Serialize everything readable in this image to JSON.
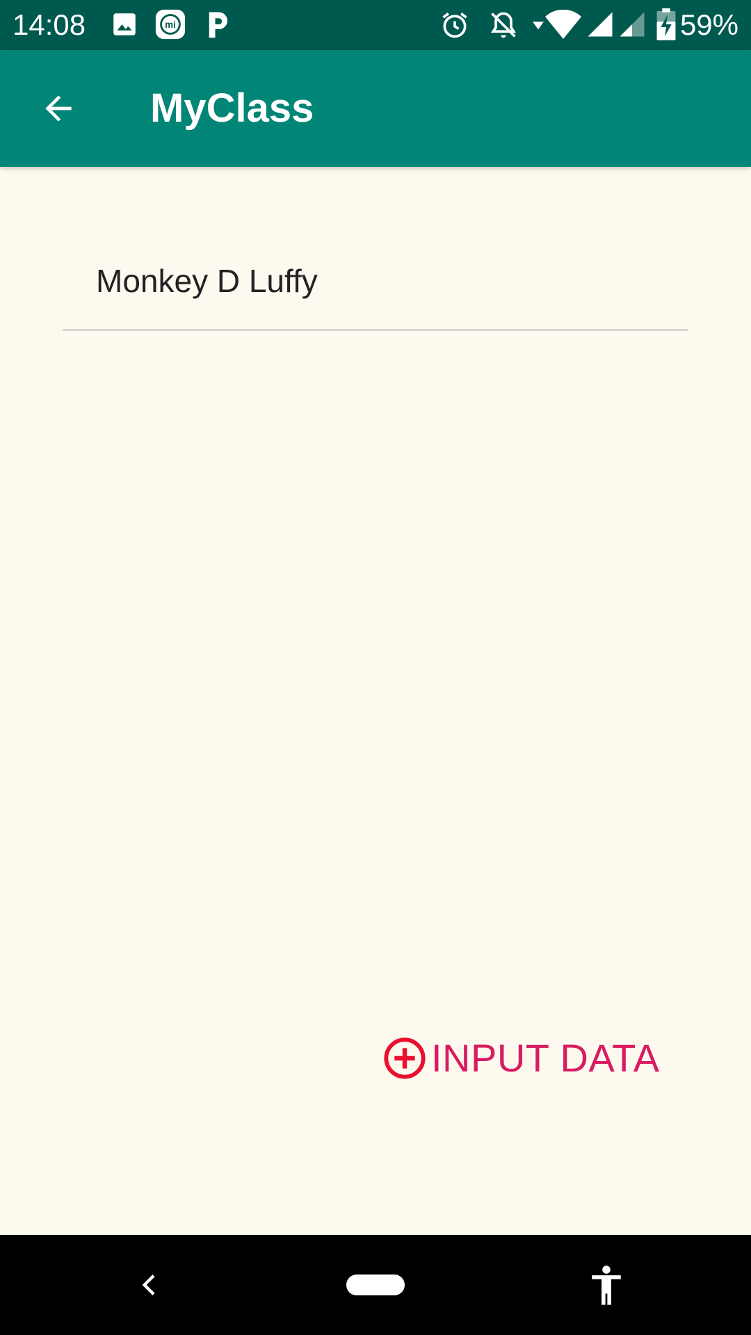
{
  "status_bar": {
    "time": "14:08",
    "battery_percent": "59%",
    "icons": [
      "image-icon",
      "mi-app-icon",
      "p-app-icon",
      "alarm-icon",
      "notifications-off-icon",
      "wifi-icon",
      "signal-icon",
      "signal-weak-icon",
      "battery-charging-icon"
    ]
  },
  "app_bar": {
    "title": "MyClass",
    "back_icon": "arrow-back-icon"
  },
  "form": {
    "name_value": "Monkey D Luffy"
  },
  "actions": {
    "input_data_label": "INPUT DATA",
    "input_data_icon": "add-circle-icon"
  },
  "nav_bar": {
    "items": [
      "back-icon",
      "home-pill-icon",
      "accessibility-icon"
    ]
  },
  "colors": {
    "status_bar": "#00594e",
    "app_bar": "#008577",
    "background": "#fdf9ef",
    "accent": "#d81b60",
    "icon_red": "#e8102e"
  }
}
